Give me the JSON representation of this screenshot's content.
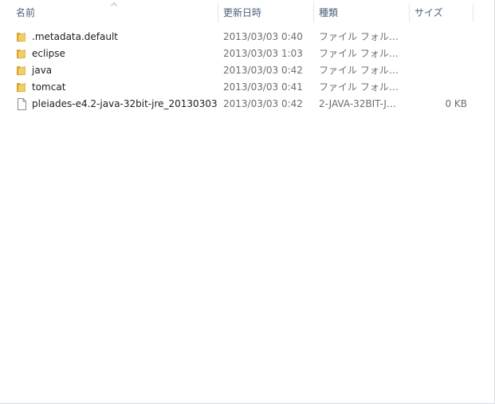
{
  "columns": {
    "name": "名前",
    "date": "更新日時",
    "type": "種類",
    "size": "サイズ"
  },
  "files": [
    {
      "name": ".metadata.default",
      "date": "2013/03/03 0:40",
      "type": "ファイル フォル…",
      "size": "",
      "icon": "folder-icon"
    },
    {
      "name": "eclipse",
      "date": "2013/03/03 1:03",
      "type": "ファイル フォル…",
      "size": "",
      "icon": "folder-icon"
    },
    {
      "name": "java",
      "date": "2013/03/03 0:42",
      "type": "ファイル フォル…",
      "size": "",
      "icon": "folder-icon"
    },
    {
      "name": "tomcat",
      "date": "2013/03/03 0:41",
      "type": "ファイル フォル…",
      "size": "",
      "icon": "folder-icon"
    },
    {
      "name": "pleiades-e4.2-java-32bit-jre_20130303",
      "date": "2013/03/03 0:42",
      "type": "2-JAVA-32BIT-J…",
      "size": "0 KB",
      "icon": "file-icon"
    }
  ],
  "colors": {
    "header_text": "#4c607a",
    "folder": "#e8b93f",
    "secondary_text": "#6d6d6d"
  }
}
